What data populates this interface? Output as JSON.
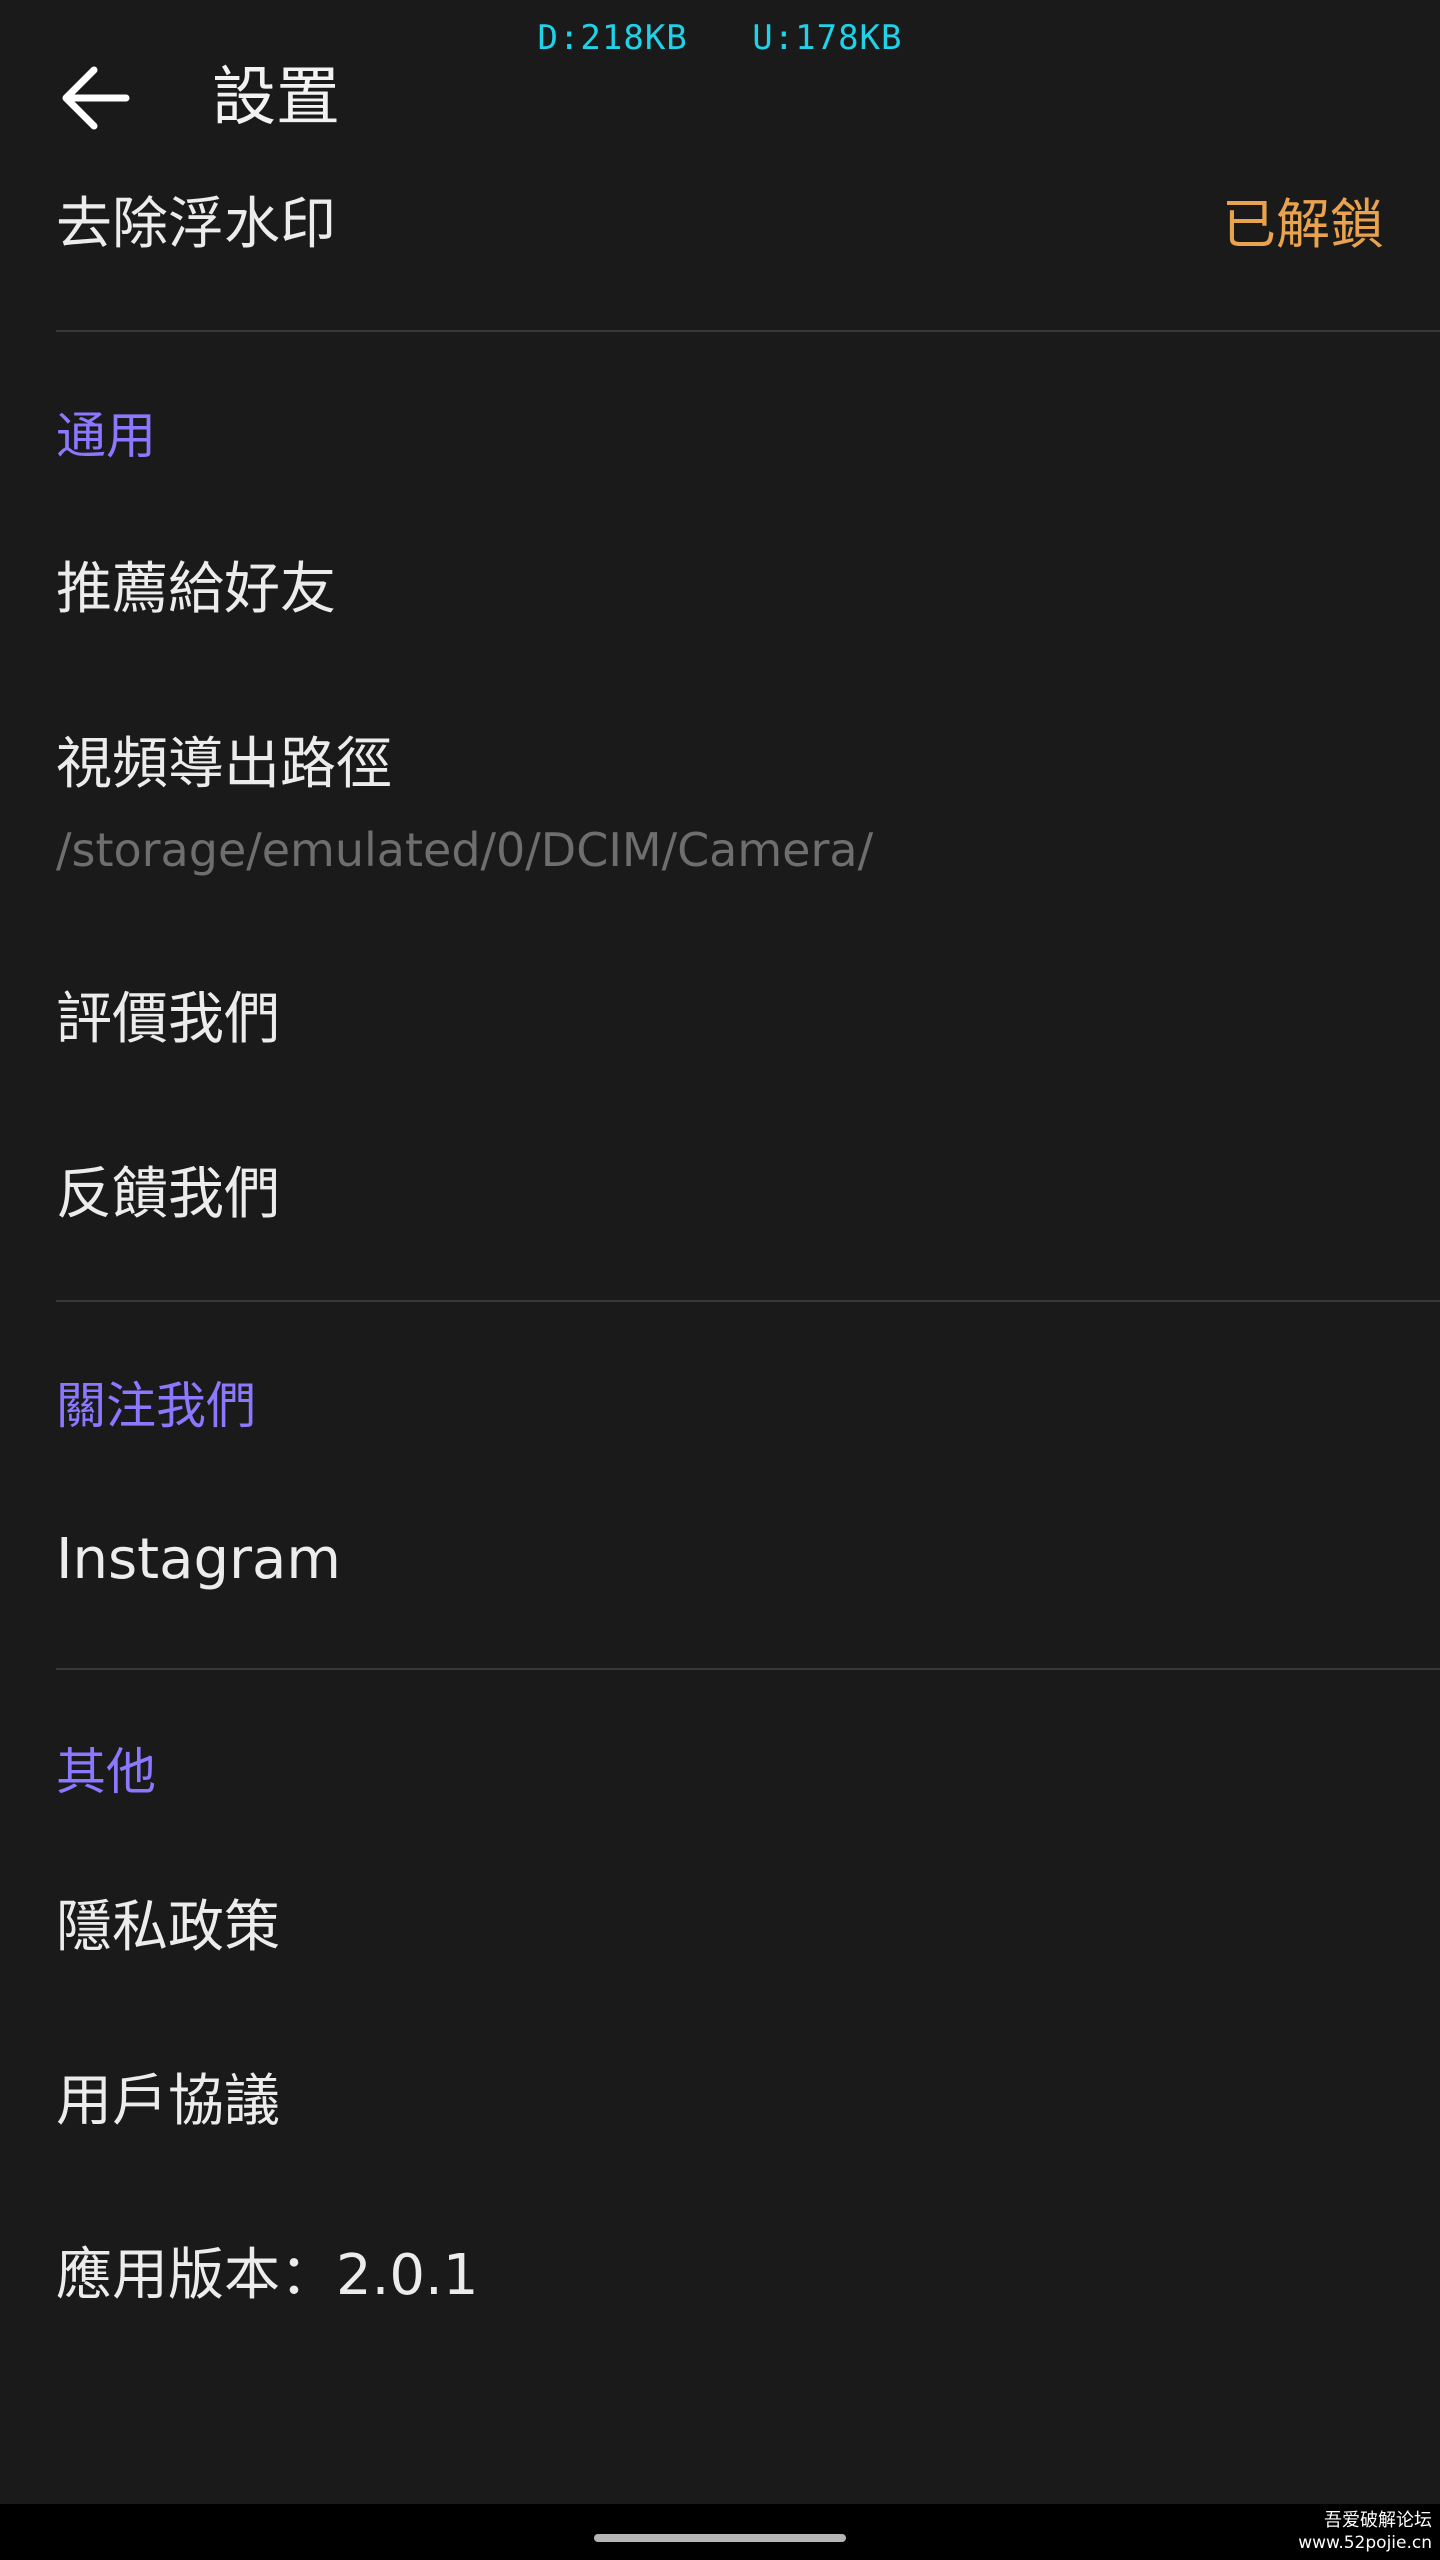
{
  "status_bar": {
    "download_speed": "D:218KB",
    "upload_speed": "U:178KB"
  },
  "app_bar": {
    "back_icon": "arrow-left-icon",
    "title": "設置"
  },
  "watermark_row": {
    "label": "去除浮水印",
    "status": "已解鎖",
    "status_color": "#e9a24e"
  },
  "sections": {
    "general": {
      "header": "通用",
      "recommend": "推薦給好友",
      "export_path_label": "視頻導出路徑",
      "export_path_value": "/storage/emulated/0/DCIM/Camera/",
      "rate": "評價我們",
      "feedback": "反饋我們"
    },
    "follow": {
      "header": "關注我們",
      "instagram": "Instagram"
    },
    "other": {
      "header": "其他",
      "privacy": "隱私政策",
      "user_agreement": "用戶協議",
      "version": "應用版本：2.0.1"
    }
  },
  "theme": {
    "background": "#1a1a1a",
    "section_header_color": "#8b78ff",
    "netspeed_color": "#1fd2e8"
  },
  "corner_watermark": {
    "name": "吾爱破解论坛",
    "url": "www.52pojie.cn"
  }
}
